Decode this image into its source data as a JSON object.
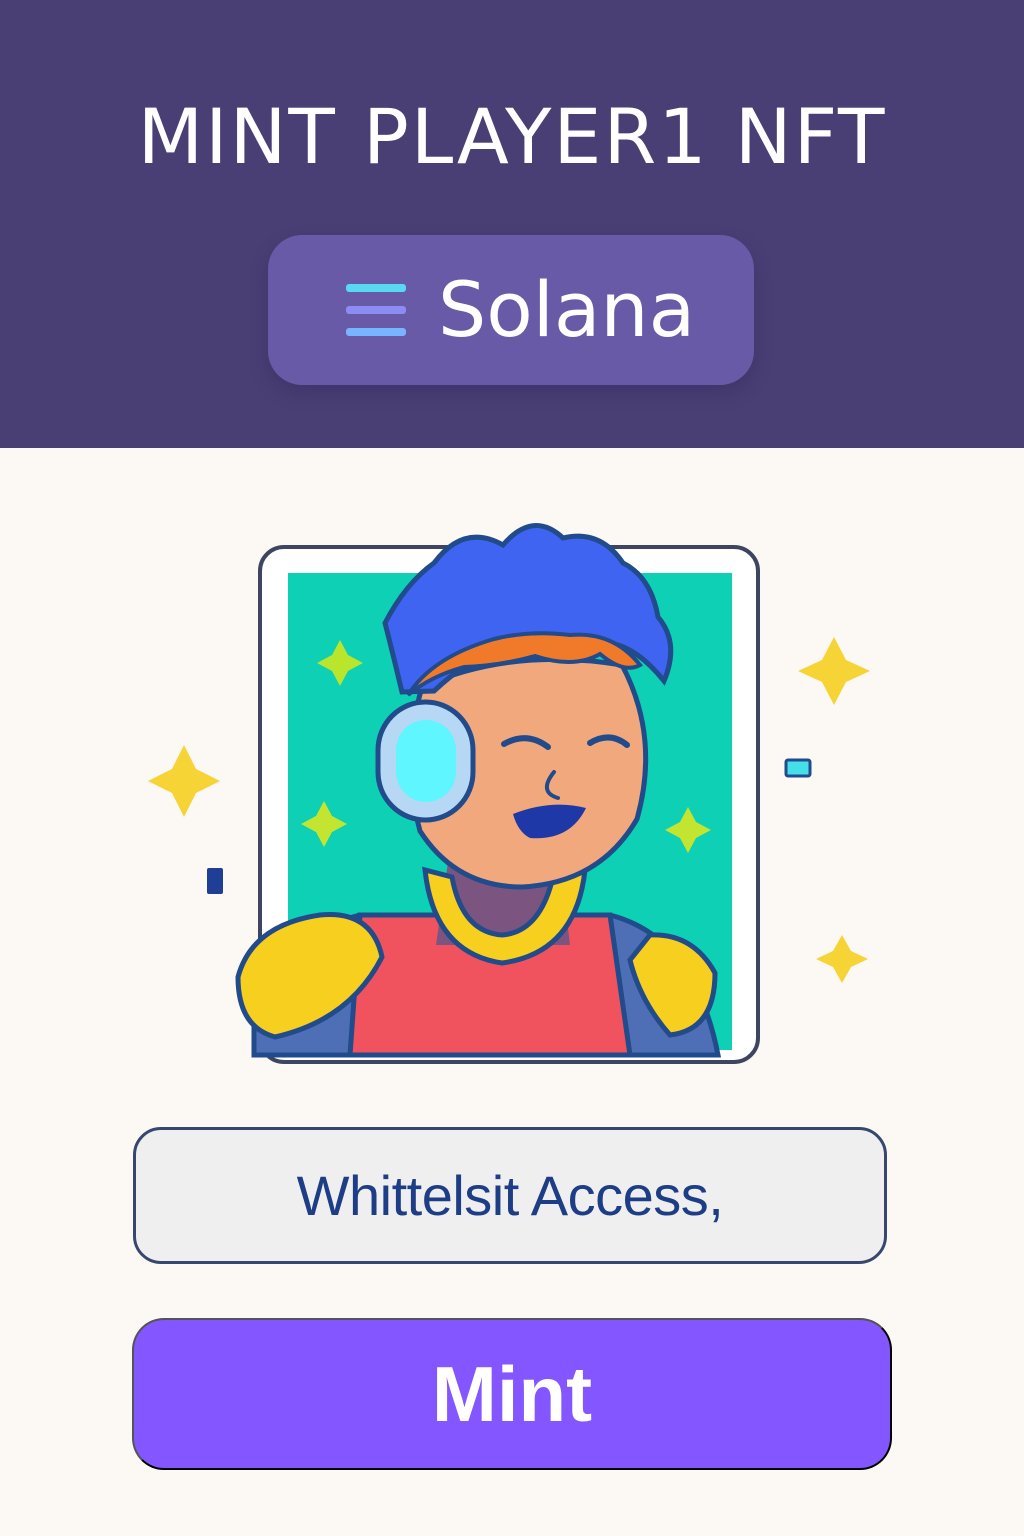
{
  "header": {
    "title": "MINT PLAYER1 NFT",
    "chain": {
      "label": "Solana",
      "icon": "solana-icon"
    }
  },
  "nft_preview": {
    "description": "player avatar illustration",
    "colors": {
      "background": "#0ed0b5",
      "hair": "#3f64f2",
      "hair_fringe": "#f07a2a",
      "skin": "#f1a87d",
      "headset": "#5ff6ff",
      "shirt": "#f0535d",
      "collar": "#f7cf1f"
    }
  },
  "access": {
    "label": "Whittelsit Access,"
  },
  "actions": {
    "mint_label": "Mint"
  },
  "colors": {
    "header_bg": "#4a3f75",
    "pill_bg": "#685aa6",
    "page_bg": "#fcf8f3",
    "button_bg": "#8356ff",
    "access_text": "#1d3d86"
  }
}
